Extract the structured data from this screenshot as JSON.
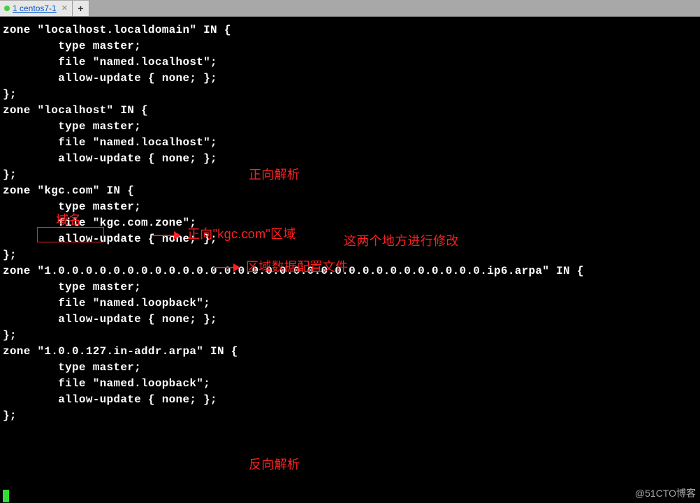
{
  "tabs": {
    "active": {
      "label": "1 centos7-1"
    },
    "newtab": "+"
  },
  "terminal": {
    "lines": [
      "zone \"localhost.localdomain\" IN {",
      "        type master;",
      "        file \"named.localhost\";",
      "        allow-update { none; };",
      "};",
      "",
      "zone \"localhost\" IN {",
      "        type master;",
      "        file \"named.localhost\";",
      "        allow-update { none; };",
      "};",
      "",
      "zone \"kgc.com\" IN {",
      "        type master;",
      "        file \"kgc.com.zone\";",
      "        allow-update { none; };",
      "};",
      "",
      "zone \"1.0.0.0.0.0.0.0.0.0.0.0.0.0.0.0.0.0.0.0.0.0.0.0.0.0.0.0.0.0.0.0.ip6.arpa\" IN {",
      "        type master;",
      "        file \"named.loopback\";",
      "        allow-update { none; };",
      "};",
      "",
      "zone \"1.0.0.127.in-addr.arpa\" IN {",
      "        type master;",
      "        file \"named.loopback\";",
      "        allow-update { none; };",
      "};"
    ]
  },
  "annotations": {
    "forward_resolve": "正向解析",
    "domain_label": "域名",
    "forward_zone": "正向\"kgc.com\"区域",
    "modify_note": "这两个地方进行修改",
    "zone_file": "区域数据配置文件",
    "reverse_resolve": "反向解析"
  },
  "watermark": "@51CTO博客"
}
